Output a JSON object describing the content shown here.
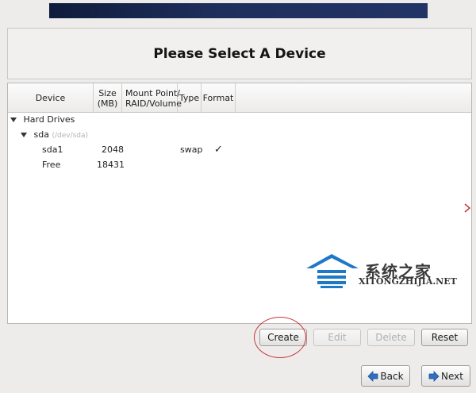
{
  "dialog": {
    "title": "Please Select A Device"
  },
  "table": {
    "columns": [
      {
        "label": "Device"
      },
      {
        "label": "Size\n(MB)"
      },
      {
        "label": "Mount Point/\nRAID/Volume"
      },
      {
        "label": "Type"
      },
      {
        "label": "Format"
      }
    ],
    "group_label": "Hard Drives",
    "drive": {
      "name": "sda",
      "path": "(/dev/sda)"
    },
    "rows": [
      {
        "device": "sda1",
        "size": "2048",
        "mount": "",
        "type": "swap",
        "format": "✓"
      },
      {
        "device": "Free",
        "size": "18431",
        "mount": "",
        "type": "",
        "format": ""
      }
    ]
  },
  "watermark": {
    "text": "系统之家",
    "url": "XITONGZHIJIA.NET"
  },
  "actions": {
    "create": "Create",
    "edit": "Edit",
    "delete": "Delete",
    "reset": "Reset"
  },
  "nav": {
    "back": "Back",
    "next": "Next"
  },
  "colors": {
    "highlight_circle": "#c8343a",
    "watermark_blue": "#1e78c8"
  }
}
